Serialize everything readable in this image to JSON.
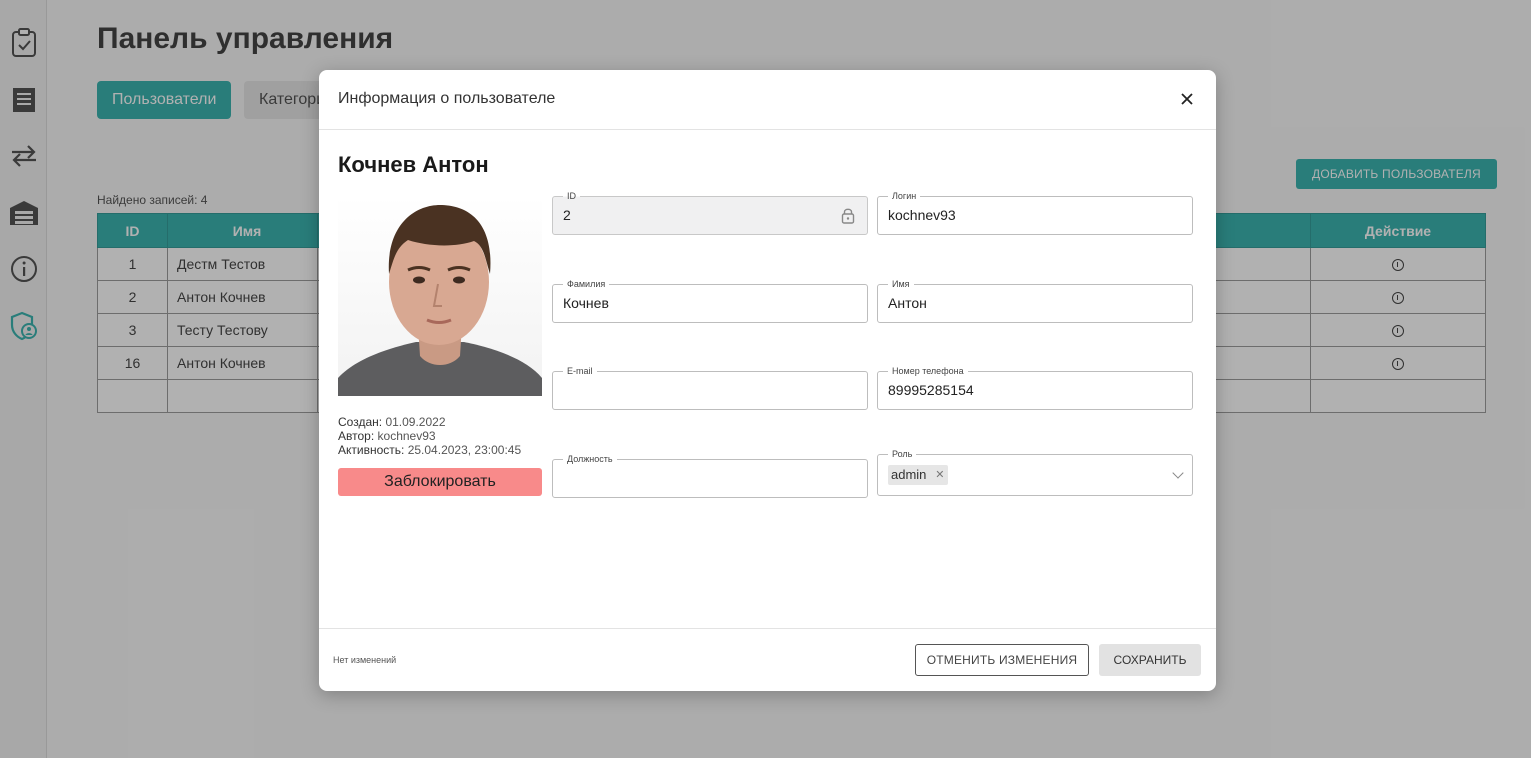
{
  "page": {
    "title": "Панель управления",
    "tabs": [
      {
        "label": "Пользователи"
      },
      {
        "label": "Категории"
      }
    ],
    "add_user_label": "ДОБАВИТЬ ПОЛЬЗОВАТЕЛЯ",
    "found_records": "Найдено записей: 4",
    "table": {
      "headers": {
        "id": "ID",
        "name": "Имя",
        "action": "Действие"
      },
      "rows": [
        {
          "id": "1",
          "name": "Дестм Тестов"
        },
        {
          "id": "2",
          "name": "Антон Кочнев"
        },
        {
          "id": "3",
          "name": "Тесту Тестову"
        },
        {
          "id": "16",
          "name": "Антон Кочнев"
        }
      ]
    }
  },
  "sidebar": {
    "icons": [
      "clipboard-check-icon",
      "receipt-icon",
      "transfer-arrows-icon",
      "warehouse-icon",
      "info-icon",
      "shield-user-icon"
    ],
    "accent": "#16a5a0"
  },
  "modal": {
    "title": "Информация о пользователе",
    "user_name": "Кочнев Антон",
    "meta": {
      "created_label": "Создан:",
      "created_value": "01.09.2022",
      "author_label": "Автор:",
      "author_value": "kochnev93",
      "activity_label": "Активность:",
      "activity_value": "25.04.2023, 23:00:45"
    },
    "block_label": "Заблокировать",
    "fields": {
      "id": {
        "label": "ID",
        "value": "2"
      },
      "login": {
        "label": "Логин",
        "value": "kochnev93"
      },
      "surname": {
        "label": "Фамилия",
        "value": "Кочнев"
      },
      "first_name": {
        "label": "Имя",
        "value": "Антон"
      },
      "email": {
        "label": "E-mail",
        "value": ""
      },
      "phone": {
        "label": "Номер телефона",
        "value": "89995285154"
      },
      "position": {
        "label": "Должность",
        "value": ""
      },
      "role": {
        "label": "Роль",
        "value": "admin"
      }
    },
    "footer": {
      "status": "Нет изменений",
      "cancel_label": "ОТМЕНИТЬ ИЗМЕНЕНИЯ",
      "save_label": "СОХРАНИТЬ"
    }
  },
  "colors": {
    "accent": "#16a5a0",
    "block_button": "#f88a8a"
  }
}
